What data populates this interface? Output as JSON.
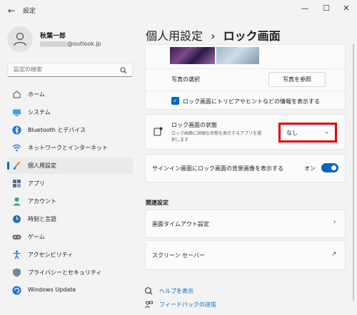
{
  "window": {
    "title": "設定",
    "back_glyph": "←",
    "minimize_glyph": "—",
    "maximize_glyph": "☐",
    "close_glyph": "✕"
  },
  "user": {
    "name": "秋葉一郎",
    "email_visible": "@outlook.jp"
  },
  "search": {
    "placeholder": "設定の検索"
  },
  "sidebar": {
    "items": [
      {
        "label": "ホーム",
        "icon": "home-icon"
      },
      {
        "label": "システム",
        "icon": "system-icon"
      },
      {
        "label": "Bluetooth とデバイス",
        "icon": "bluetooth-icon"
      },
      {
        "label": "ネットワークとインターネット",
        "icon": "wifi-icon"
      },
      {
        "label": "個人用設定",
        "icon": "brush-icon",
        "active": true
      },
      {
        "label": "アプリ",
        "icon": "apps-icon"
      },
      {
        "label": "アカウント",
        "icon": "account-icon"
      },
      {
        "label": "時刻と言語",
        "icon": "time-language-icon"
      },
      {
        "label": "ゲーム",
        "icon": "gamepad-icon"
      },
      {
        "label": "アクセシビリティ",
        "icon": "accessibility-icon"
      },
      {
        "label": "プライバシーとセキュリティ",
        "icon": "shield-icon"
      },
      {
        "label": "Windows Update",
        "icon": "update-icon"
      }
    ]
  },
  "breadcrumb": {
    "parent": "個人用設定",
    "separator": "›",
    "current": "ロック画面"
  },
  "photo_section": {
    "select_photo_label": "写真の選択",
    "browse_button": "写真を参照",
    "trivia_checkbox_label": "ロック画面にトリビアやヒントなどの情報を表示する",
    "trivia_checked": true
  },
  "lock_status": {
    "title": "ロック画面の状態",
    "description_line1": "ロック画面に詳細な状態を表示するアプリを選",
    "description_line2": "択します",
    "dropdown_value": "なし",
    "chevron": "⌄"
  },
  "signin_background": {
    "label": "サインイン画面にロック画面の背景画像を表示する",
    "state_label": "オン",
    "on": true
  },
  "related": {
    "title": "関連設定",
    "screen_timeout": "画面タイムアウト設定",
    "screen_saver": "スクリーン セーバー",
    "chevron": "›",
    "external_glyph": "↗"
  },
  "help": {
    "get_help": "ヘルプを表示",
    "feedback": "フィードバックの送信"
  },
  "colors": {
    "accent": "#0067c0",
    "highlight_border": "#e00000"
  }
}
